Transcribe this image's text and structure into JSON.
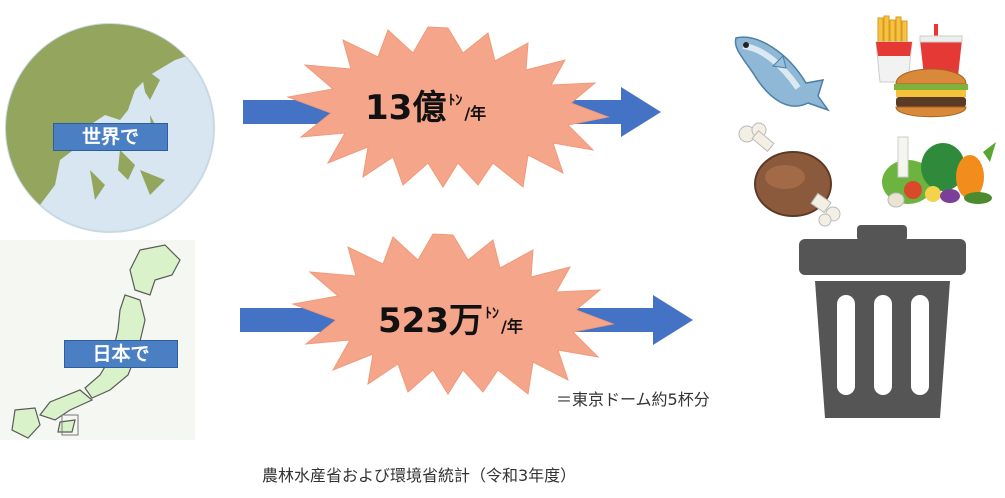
{
  "world": {
    "label": "世界で",
    "amount": "13億",
    "unit_ton": "ﾄﾝ",
    "unit_year": "/年"
  },
  "japan": {
    "label": "日本で",
    "amount": "523万",
    "unit_ton": "ﾄﾝ",
    "unit_year": "/年"
  },
  "note": "＝東京ドーム約5杯分",
  "source": "農林水産省および環境省統計（令和3年度）",
  "colors": {
    "arrow": "#4472c4",
    "burst": "#f4a58a",
    "label_bg": "#4a7fc4",
    "trash": "#555555"
  },
  "icons": [
    "globe-map-icon",
    "japan-map-icon",
    "fish-icon",
    "meat-icon",
    "burger-fries-drink-icon",
    "vegetables-icon",
    "trash-can-icon"
  ]
}
